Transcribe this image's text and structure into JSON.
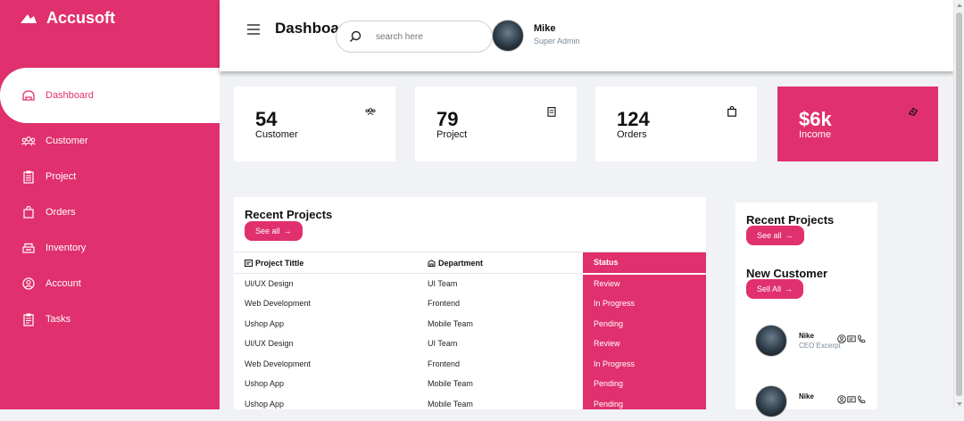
{
  "brand": {
    "name": "Accusoft"
  },
  "sidebar": {
    "items": [
      {
        "label": "Dashboard",
        "icon": "dashboard-icon",
        "active": true
      },
      {
        "label": "Customer",
        "icon": "users-icon"
      },
      {
        "label": "Project",
        "icon": "clipboard-icon"
      },
      {
        "label": "Orders",
        "icon": "bag-icon"
      },
      {
        "label": "Inventory",
        "icon": "inventory-icon"
      },
      {
        "label": "Account",
        "icon": "account-icon"
      },
      {
        "label": "Tasks",
        "icon": "tasks-icon"
      }
    ]
  },
  "header": {
    "title": "Dashboard",
    "search_placeholder": "search here",
    "user_name": "Mike",
    "user_role": "Super Admin"
  },
  "cards": [
    {
      "value": "54",
      "label": "Customer",
      "icon": "users-icon"
    },
    {
      "value": "79",
      "label": "Project",
      "icon": "clipboard-icon"
    },
    {
      "value": "124",
      "label": "Orders",
      "icon": "bag-icon"
    },
    {
      "value": "$6k",
      "label": "Income",
      "icon": "money-icon"
    }
  ],
  "recent_projects": {
    "title": "Recent Projects",
    "button": "See all",
    "columns": [
      "Project Tittle",
      "Department",
      "Status"
    ],
    "rows": [
      [
        "UI/UX Design",
        "UI Team",
        "Review"
      ],
      [
        "Web Development",
        "Frontend",
        "In Progress"
      ],
      [
        "Ushop App",
        "Mobile Team",
        "Pending"
      ],
      [
        "UI/UX Design",
        "UI Team",
        "Review"
      ],
      [
        "Web Development",
        "Frontend",
        "In Progress"
      ],
      [
        "Ushop App",
        "Mobile Team",
        "Pending"
      ],
      [
        "Ushop App",
        "Mobile Team",
        "Pending"
      ]
    ]
  },
  "side_panel": {
    "recent_title": "Recent Projects",
    "recent_button": "See all",
    "customer_title": "New Customer",
    "customer_button": "Sell All",
    "customers": [
      {
        "name": "Nike",
        "role": "CEO Excerpt"
      },
      {
        "name": "Nike",
        "role": ""
      }
    ]
  },
  "colors": {
    "accent": "#e0306e",
    "background": "#f0f2f5"
  }
}
